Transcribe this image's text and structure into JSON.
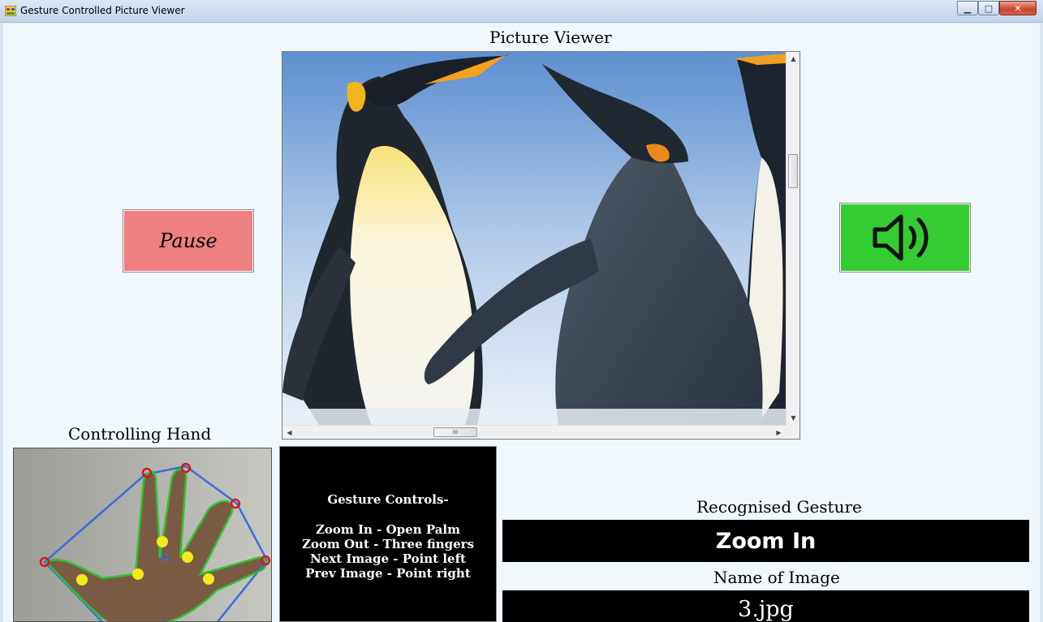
{
  "window": {
    "title": "Gesture Controlled Picture Viewer",
    "minimize_glyph": "▁",
    "maximize_glyph": "□",
    "close_glyph": "✕"
  },
  "viewer": {
    "label": "Picture Viewer",
    "scroll_up": "▲",
    "scroll_down": "▼",
    "scroll_left": "◀",
    "scroll_right": "▶",
    "thumb_grip": "III"
  },
  "pause_button": {
    "label": "Pause"
  },
  "sound_button": {
    "icon": "speaker-icon",
    "color": "#33cc33"
  },
  "hand": {
    "label": "Controlling Hand"
  },
  "controls": {
    "title": "Gesture Controls-",
    "lines": [
      "Zoom In - Open Palm",
      "Zoom Out - Three fingers",
      "Next Image - Point left",
      "Prev Image - Point right"
    ]
  },
  "recognised": {
    "label": "Recognised Gesture",
    "value": "Zoom In"
  },
  "image_name": {
    "label": "Name of Image",
    "value": "3.jpg"
  },
  "colors": {
    "pause": "#ef8080",
    "sound": "#33cc33",
    "panel": "#000000",
    "client_bg": "#f0f7fd"
  }
}
